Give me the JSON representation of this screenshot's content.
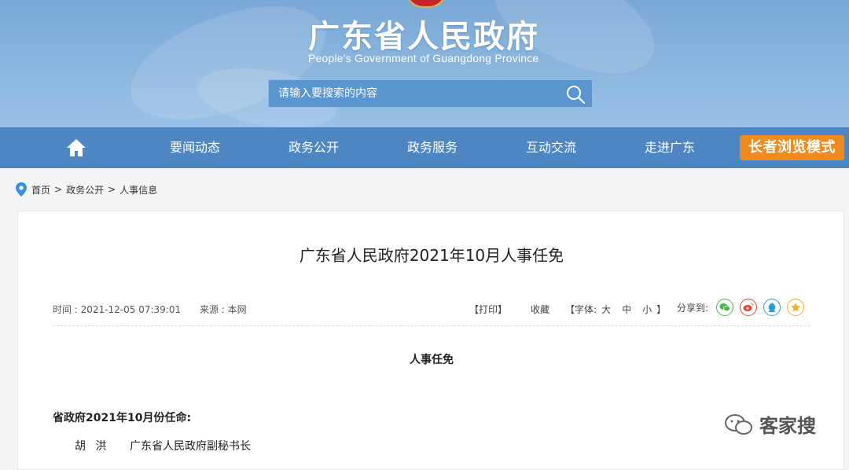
{
  "header": {
    "title": "广东省人民政府",
    "subtitle": "People's Government of Guangdong Province",
    "search_placeholder": "请输入要搜索的内容"
  },
  "nav": {
    "items": [
      "要闻动态",
      "政务公开",
      "政务服务",
      "互动交流",
      "走进广东"
    ],
    "elder_mode": "长者浏览模式"
  },
  "breadcrumb": {
    "items": [
      "首页",
      "政务公开",
      "人事信息"
    ],
    "separator": ">"
  },
  "article": {
    "title": "广东省人民政府2021年10月人事任免",
    "time": "时间 : 2021-12-05 07:39:01",
    "source": "来源 : 本网",
    "tools": {
      "print": "【打印】",
      "favorite": "收藏",
      "font_open": "【字体:",
      "font_large": "大",
      "font_medium": "中",
      "font_small": "小",
      "font_close": "】"
    },
    "share_label": "分享到:",
    "share_icons": [
      "wechat-icon",
      "weibo-icon",
      "qq-icon",
      "qzone-icon"
    ],
    "heading": "人事任免",
    "section_label": "省政府2021年10月份任命:",
    "appointments": [
      {
        "name": "胡 洪",
        "position": "广东省人民政府副秘书长"
      }
    ]
  },
  "watermark": "客家搜",
  "colors": {
    "banner": "#8bb6df",
    "nav": "#4e86c4",
    "elder_button": "#f08a1c",
    "search_box": "#5a95cf"
  }
}
